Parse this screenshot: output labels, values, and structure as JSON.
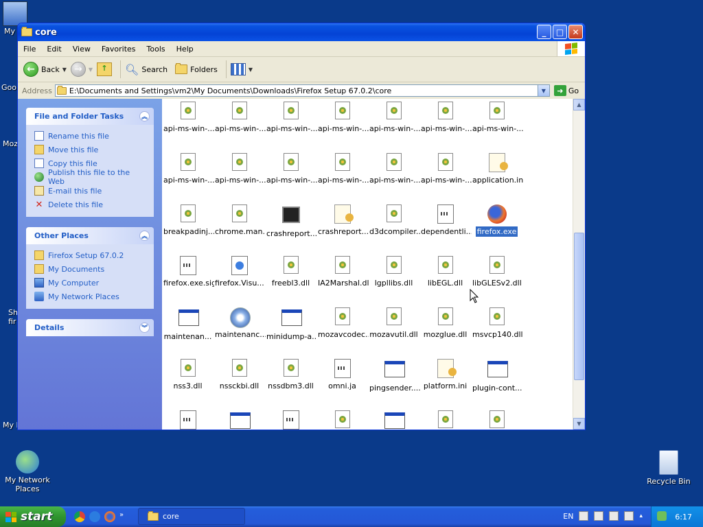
{
  "desktop": {
    "icons": {
      "my_computer_label": "My",
      "network_places_label": "My Network Places",
      "recycle_bin_label": "Recycle Bin"
    },
    "side_labels": [
      "Goo",
      "Moz",
      "Sh",
      "fir",
      "My I"
    ]
  },
  "window": {
    "title": "core",
    "menu": [
      "File",
      "Edit",
      "View",
      "Favorites",
      "Tools",
      "Help"
    ],
    "toolbar": {
      "back_label": "Back",
      "search_label": "Search",
      "folders_label": "Folders"
    },
    "address": {
      "label": "Address",
      "path": "E:\\Documents and Settings\\vm2\\My Documents\\Downloads\\Firefox Setup 67.0.2\\core",
      "go_label": "Go"
    },
    "taskpane": {
      "file_tasks": {
        "title": "File and Folder Tasks",
        "items": [
          "Rename this file",
          "Move this file",
          "Copy this file",
          "Publish this file to the Web",
          "E-mail this file",
          "Delete this file"
        ]
      },
      "other_places": {
        "title": "Other Places",
        "items": [
          "Firefox Setup 67.0.2",
          "My Documents",
          "My Computer",
          "My Network Places"
        ]
      },
      "details": {
        "title": "Details"
      }
    },
    "files": [
      {
        "name": "api-ms-win-...",
        "icon": "dll"
      },
      {
        "name": "api-ms-win-...",
        "icon": "dll"
      },
      {
        "name": "api-ms-win-...",
        "icon": "dll"
      },
      {
        "name": "api-ms-win-...",
        "icon": "dll"
      },
      {
        "name": "api-ms-win-...",
        "icon": "dll"
      },
      {
        "name": "api-ms-win-...",
        "icon": "dll"
      },
      {
        "name": "api-ms-win-...",
        "icon": "dll"
      },
      {
        "name": "api-ms-win-...",
        "icon": "dll"
      },
      {
        "name": "api-ms-win-...",
        "icon": "dll"
      },
      {
        "name": "api-ms-win-...",
        "icon": "dll"
      },
      {
        "name": "api-ms-win-...",
        "icon": "dll"
      },
      {
        "name": "api-ms-win-...",
        "icon": "dll"
      },
      {
        "name": "api-ms-win-...",
        "icon": "dll"
      },
      {
        "name": "application.ini",
        "icon": "ini"
      },
      {
        "name": "breakpadinj...",
        "icon": "dll"
      },
      {
        "name": "chrome.man...",
        "icon": "dll"
      },
      {
        "name": "crashreport...",
        "icon": "dark"
      },
      {
        "name": "crashreport...",
        "icon": "ini"
      },
      {
        "name": "d3dcompiler...",
        "icon": "dll"
      },
      {
        "name": "dependentli...",
        "icon": "txt"
      },
      {
        "name": "firefox.exe",
        "icon": "ff",
        "selected": true
      },
      {
        "name": "firefox.exe.sig",
        "icon": "txt"
      },
      {
        "name": "firefox.Visu...",
        "icon": "html"
      },
      {
        "name": "freebl3.dll",
        "icon": "dll"
      },
      {
        "name": "IA2Marshal.dll",
        "icon": "dll"
      },
      {
        "name": "lgpllibs.dll",
        "icon": "dll"
      },
      {
        "name": "libEGL.dll",
        "icon": "dll"
      },
      {
        "name": "libGLESv2.dll",
        "icon": "dll"
      },
      {
        "name": "maintenan...",
        "icon": "win"
      },
      {
        "name": "maintenanc...",
        "icon": "inst"
      },
      {
        "name": "minidump-a...",
        "icon": "win"
      },
      {
        "name": "mozavcodec...",
        "icon": "dll"
      },
      {
        "name": "mozavutil.dll",
        "icon": "dll"
      },
      {
        "name": "mozglue.dll",
        "icon": "dll"
      },
      {
        "name": "msvcp140.dll",
        "icon": "dll"
      },
      {
        "name": "nss3.dll",
        "icon": "dll"
      },
      {
        "name": "nssckbi.dll",
        "icon": "dll"
      },
      {
        "name": "nssdbm3.dll",
        "icon": "dll"
      },
      {
        "name": "omni.ja",
        "icon": "txt"
      },
      {
        "name": "pingsender....",
        "icon": "win"
      },
      {
        "name": "platform.ini",
        "icon": "ini"
      },
      {
        "name": "plugin-cont...",
        "icon": "win"
      },
      {
        "name": "",
        "icon": "txt"
      },
      {
        "name": "",
        "icon": "win"
      },
      {
        "name": "",
        "icon": "txt"
      },
      {
        "name": "",
        "icon": "dll"
      },
      {
        "name": "",
        "icon": "win"
      },
      {
        "name": "",
        "icon": "dll"
      },
      {
        "name": "",
        "icon": "dll"
      }
    ]
  },
  "taskbar": {
    "start_label": "start",
    "task_label": "core",
    "lang": "EN",
    "clock": "6:17"
  }
}
